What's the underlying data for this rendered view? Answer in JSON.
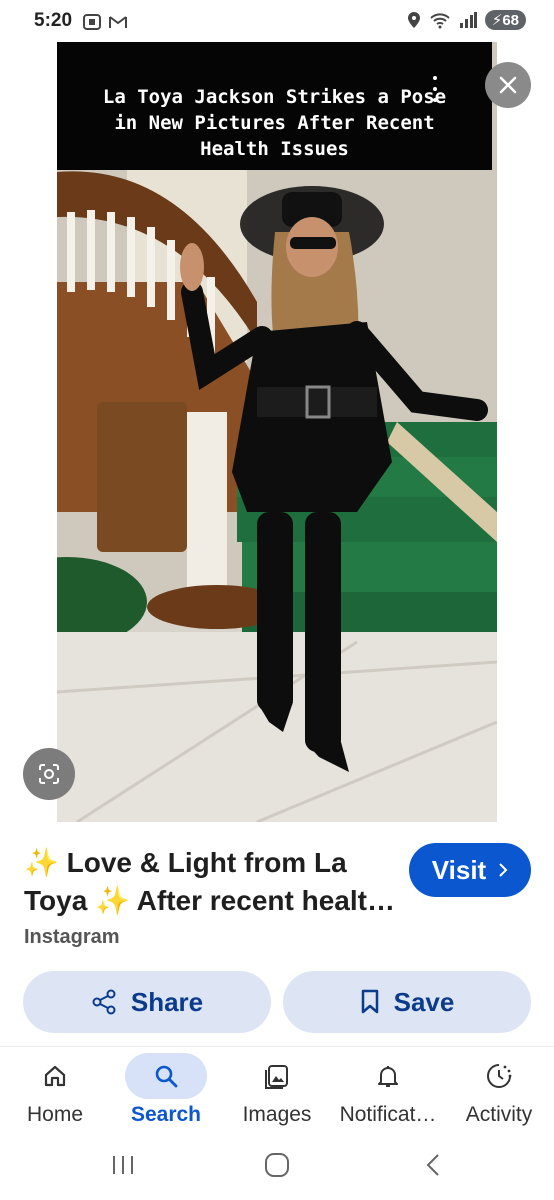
{
  "status_bar": {
    "time": "5:20",
    "battery": "68",
    "icons": [
      "screenshot-icon",
      "gmail-icon",
      "location-icon",
      "wifi-icon",
      "signal-icon",
      "battery-icon"
    ]
  },
  "viewer": {
    "caption_lines": [
      "La Toya Jackson Strikes a Pose",
      "in New Pictures After Recent",
      "Health Issues"
    ]
  },
  "result": {
    "title_line1": "✨ Love & Light from La",
    "title_line2": "Toya ✨ After recent healt…",
    "source": "Instagram",
    "visit_label": "Visit"
  },
  "actions": {
    "share_label": "Share",
    "save_label": "Save"
  },
  "bottom_nav": {
    "items": [
      {
        "label": "Home",
        "icon": "home-icon"
      },
      {
        "label": "Search",
        "icon": "search-icon"
      },
      {
        "label": "Images",
        "icon": "images-icon"
      },
      {
        "label": "Notificat…",
        "icon": "bell-icon"
      },
      {
        "label": "Activity",
        "icon": "activity-icon"
      }
    ],
    "active": "Search"
  },
  "colors": {
    "accent": "#0b57d0",
    "pill_bg": "#dde5f5",
    "caption_bg": "#050505"
  }
}
